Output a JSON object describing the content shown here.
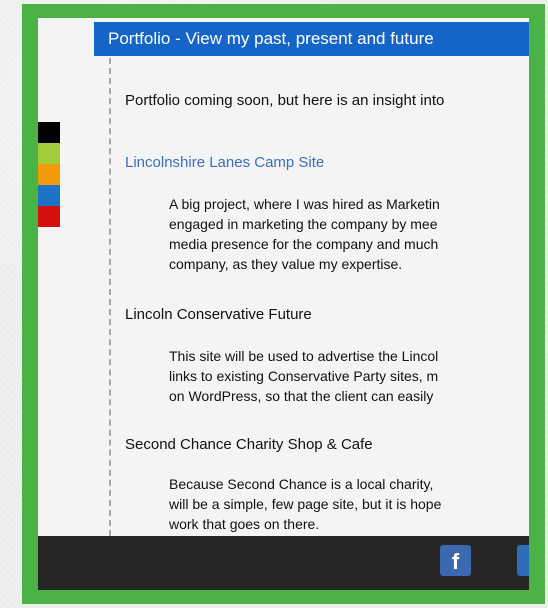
{
  "header": {
    "title": "Portfolio - View my past, present and future"
  },
  "intro": "Portfolio coming soon, but here is an insight into",
  "color_bars": [
    "#000000",
    "#a3cc3a",
    "#f29a0a",
    "#1b74c8",
    "#d60f0f"
  ],
  "projects": [
    {
      "title": "Lincolnshire Lanes Camp Site",
      "lines": [
        "A big project, where I was hired as Marketin",
        "engaged in marketing the company by mee",
        "media presence for the company and much",
        "company, as they value my expertise."
      ]
    },
    {
      "title": "Lincoln Conservative Future",
      "lines": [
        "This site will be used to advertise the Lincol",
        "links to existing Conservative Party sites, m",
        "on WordPress, so that the client can easily"
      ]
    },
    {
      "title": "Second Chance Charity Shop & Cafe",
      "lines": [
        "Because Second Chance is a local charity,",
        "will be a simple, few page site, but it is hope",
        "work that goes on there."
      ]
    }
  ],
  "footer": {
    "facebook_glyph": "f",
    "icons": [
      "facebook-icon",
      "twitter-icon"
    ]
  }
}
